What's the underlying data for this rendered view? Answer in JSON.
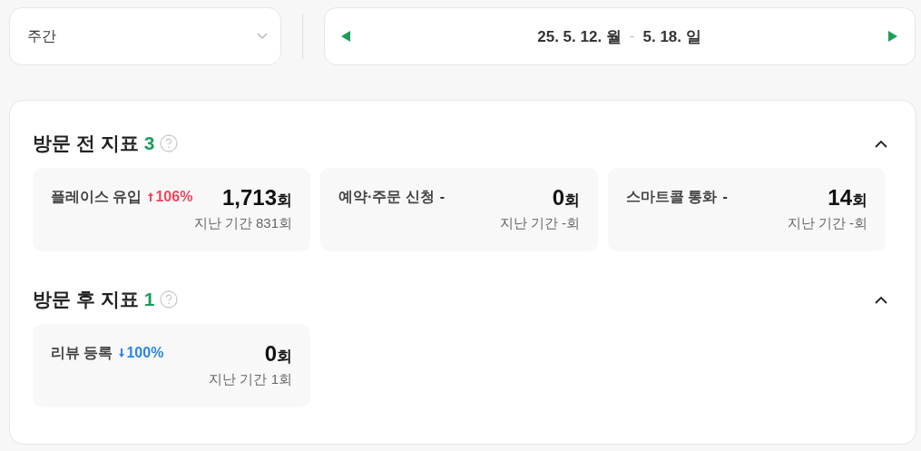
{
  "period_select": {
    "value": "주간"
  },
  "date_range": {
    "start": "25. 5. 12. 월",
    "separator": "-",
    "end": "5. 18. 일"
  },
  "sections": [
    {
      "title": "방문 전 지표",
      "count": "3",
      "expanded": true,
      "metrics": [
        {
          "label": "플레이스 유입",
          "change": {
            "kind": "up",
            "value": "106%"
          },
          "value": "1,713",
          "unit": "회",
          "previous": "지난 기간 831회"
        },
        {
          "label": "예약·주문 신청",
          "change": {
            "kind": "none",
            "value": "-"
          },
          "value": "0",
          "unit": "회",
          "previous": "지난 기간 -회"
        },
        {
          "label": "스마트콜 통화",
          "change": {
            "kind": "none",
            "value": "-"
          },
          "value": "14",
          "unit": "회",
          "previous": "지난 기간 -회"
        }
      ]
    },
    {
      "title": "방문 후 지표",
      "count": "1",
      "expanded": true,
      "metrics": [
        {
          "label": "리뷰 등록",
          "change": {
            "kind": "down",
            "value": "100%"
          },
          "value": "0",
          "unit": "회",
          "previous": "지난 기간 1회"
        }
      ]
    }
  ]
}
